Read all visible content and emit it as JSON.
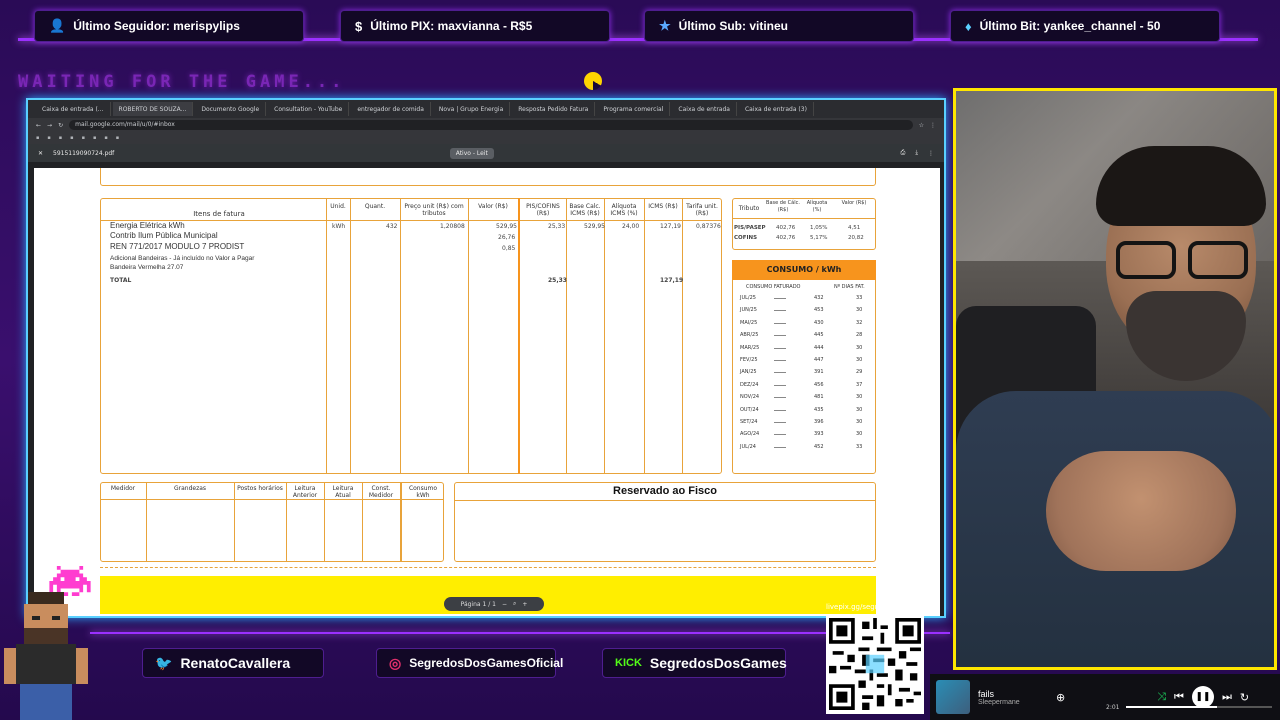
{
  "alerts": {
    "follower": {
      "icon": "user-icon",
      "text": "Último Seguidor: merispylips"
    },
    "pix": {
      "icon": "dollar-icon",
      "text": "Último PIX: maxvianna - R$5"
    },
    "sub": {
      "icon": "star-icon",
      "text": "Último Sub: vitineu"
    },
    "bit": {
      "icon": "diamond-icon",
      "text": "Último Bit: yankee_channel - 50"
    }
  },
  "retro_text": "WAITING FOR THE GAME...",
  "browser": {
    "tabs": [
      {
        "label": "Caixa de entrada (..."
      },
      {
        "label": "ROBERTO DE SOUZA..."
      },
      {
        "label": "Documento Google"
      },
      {
        "label": "Consultation - YouTube"
      },
      {
        "label": "entregador de comida"
      },
      {
        "label": "Nova | Grupo Energia"
      },
      {
        "label": "Resposta Pedido Fatura"
      },
      {
        "label": "Programa comercial"
      },
      {
        "label": "Caixa de entrada"
      },
      {
        "label": "Caixa de entrada (3)"
      }
    ],
    "url": "mail.google.com/mail/u/0/#inbox",
    "pdf_filename": "5915119090724.pdf",
    "pdf_mode": "Ativo - Leit"
  },
  "invoice": {
    "headers": {
      "items": "Itens de fatura",
      "unid": "Unid.",
      "quant": "Quant.",
      "preco": "Preço unit (R$) com tributos",
      "valor": "Valor (R$)",
      "pis": "PIS/COFINS (R$)",
      "base": "Base Calc. ICMS (R$)",
      "aliq": "Alíquota ICMS (%)",
      "icms": "ICMS (R$)",
      "tarifa": "Tarifa unit. (R$)"
    },
    "rows": [
      {
        "label": "Energia Elétrica kWh",
        "unid": "kWh",
        "quant": "432",
        "preco": "1,20808",
        "valor": "529,95",
        "pis": "25,33",
        "base": "529,95",
        "aliq": "24,00",
        "icms": "127,19",
        "tarifa": "0,87376"
      },
      {
        "label": "Contrib Ilum Pública Municipal",
        "valor": "26,76"
      },
      {
        "label": "REN 771/2017 MODULO 7 PRODIST",
        "valor": "0,85"
      },
      {
        "label": "Adicional Bandeiras - Já incluído no Valor a Pagar"
      },
      {
        "label": "Bandeira Vermelha 27.07"
      }
    ],
    "total_label": "TOTAL",
    "total_pis": "25,33",
    "total_icms": "127,19",
    "tributo": {
      "headers": {
        "tributo": "Tributo",
        "base": "Base de Cálc. (R$)",
        "aliq": "Alíquota (%)",
        "valor": "Valor (R$)"
      },
      "rows": [
        {
          "name": "PIS/PASEP",
          "base": "402,76",
          "aliq": "1,05%",
          "valor": "4,51"
        },
        {
          "name": "COFINS",
          "base": "402,76",
          "aliq": "5,17%",
          "valor": "20,82"
        }
      ]
    },
    "consumo": {
      "title": "CONSUMO / kWh",
      "col1": "CONSUMO FATURADO",
      "col2": "Nº DIAS FAT.",
      "rows": [
        {
          "mes": "JUL/25",
          "kwh": "432",
          "dias": "33"
        },
        {
          "mes": "JUN/25",
          "kwh": "453",
          "dias": "30"
        },
        {
          "mes": "MAI/25",
          "kwh": "430",
          "dias": "32"
        },
        {
          "mes": "ABR/25",
          "kwh": "445",
          "dias": "28"
        },
        {
          "mes": "MAR/25",
          "kwh": "444",
          "dias": "30"
        },
        {
          "mes": "FEV/25",
          "kwh": "447",
          "dias": "30"
        },
        {
          "mes": "JAN/25",
          "kwh": "391",
          "dias": "29"
        },
        {
          "mes": "DEZ/24",
          "kwh": "456",
          "dias": "37"
        },
        {
          "mes": "NOV/24",
          "kwh": "481",
          "dias": "30"
        },
        {
          "mes": "OUT/24",
          "kwh": "435",
          "dias": "30"
        },
        {
          "mes": "SET/24",
          "kwh": "396",
          "dias": "30"
        },
        {
          "mes": "AGO/24",
          "kwh": "393",
          "dias": "30"
        },
        {
          "mes": "JUL/24",
          "kwh": "452",
          "dias": "33"
        }
      ]
    },
    "medidor": {
      "headers": {
        "medidor": "Medidor",
        "grandezas": "Grandezas",
        "postos": "Postos horários",
        "anterior": "Leitura Anterior",
        "atual": "Leitura Atual",
        "const": "Const. Medidor",
        "consumo": "Consumo kWh"
      }
    },
    "reservado": "Reservado ao Fisco",
    "pager": "Página 1 / 1"
  },
  "social": {
    "twitter": {
      "icon": "twitter-icon",
      "text": "RenatoCavallera"
    },
    "instagram": {
      "icon": "instagram-icon",
      "text": "SegredosDosGamesOficial"
    },
    "kick": {
      "icon": "kick-icon",
      "badge": "KICK",
      "text": "SegredosDosGames"
    }
  },
  "qr_label": "livepix.gg/segredosdosgames",
  "player": {
    "track": "fails",
    "artist": "Sleepermane",
    "time": "2:01",
    "progress": 0.62
  },
  "colors": {
    "accent": "#9b30ff",
    "frame": "#5ad0ff",
    "cam_border": "#ffe600",
    "orange": "#f7941d"
  }
}
